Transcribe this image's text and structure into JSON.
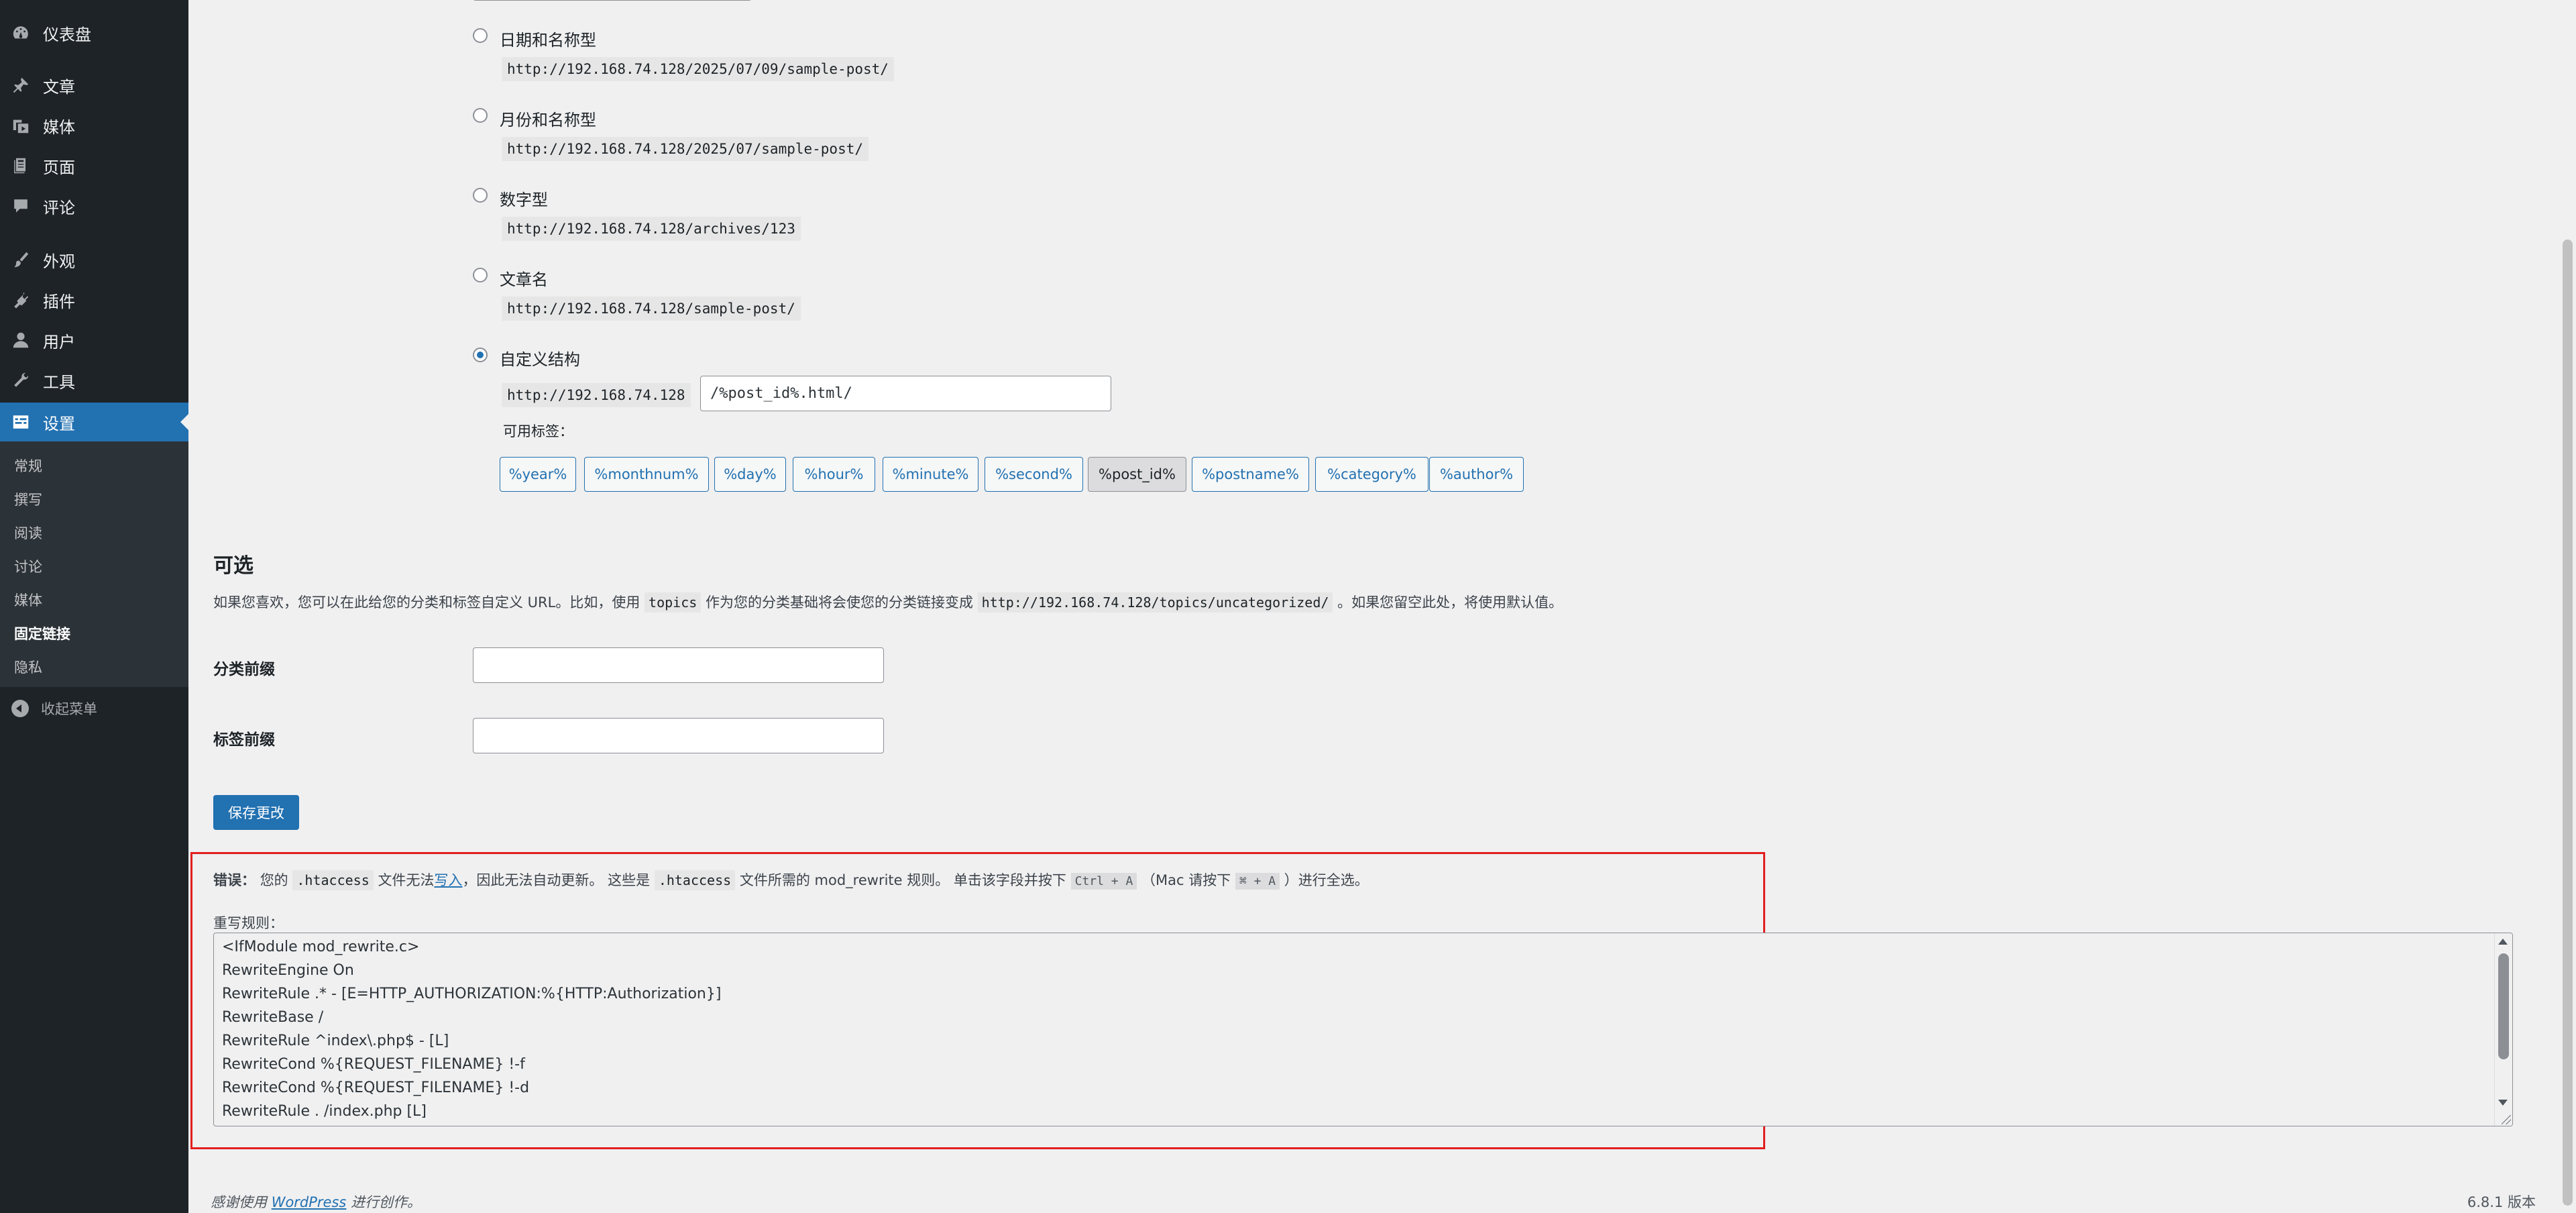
{
  "sidebar": {
    "menu": [
      {
        "label": "仪表盘",
        "icon": "dashboard-icon"
      },
      {
        "label": "文章",
        "icon": "pin-icon"
      },
      {
        "label": "媒体",
        "icon": "media-icon"
      },
      {
        "label": "页面",
        "icon": "page-icon"
      },
      {
        "label": "评论",
        "icon": "comment-icon"
      },
      {
        "label": "外观",
        "icon": "brush-icon"
      },
      {
        "label": "插件",
        "icon": "plugin-icon"
      },
      {
        "label": "用户",
        "icon": "user-icon"
      },
      {
        "label": "工具",
        "icon": "wrench-icon"
      },
      {
        "label": "设置",
        "icon": "settings-icon"
      }
    ],
    "submenu": [
      "常规",
      "撰写",
      "阅读",
      "讨论",
      "媒体",
      "固定链接",
      "隐私"
    ],
    "collapse_label": "收起菜单"
  },
  "permalink_options": [
    {
      "label": "日期和名称型",
      "url": "http://192.168.74.128/2025/07/09/sample-post/"
    },
    {
      "label": "月份和名称型",
      "url": "http://192.168.74.128/2025/07/sample-post/"
    },
    {
      "label": "数字型",
      "url": "http://192.168.74.128/archives/123"
    },
    {
      "label": "文章名",
      "url": "http://192.168.74.128/sample-post/"
    }
  ],
  "custom": {
    "label": "自定义结构",
    "base": "http://192.168.74.128",
    "value": "/%post_id%.html/",
    "available_tags_label": "可用标签：",
    "tags": [
      "%year%",
      "%monthnum%",
      "%day%",
      "%hour%",
      "%minute%",
      "%second%",
      "%post_id%",
      "%postname%",
      "%category%",
      "%author%"
    ]
  },
  "optional": {
    "heading": "可选",
    "desc_1": "如果您喜欢，您可以在此给您的分类和标签自定义 URL。比如，使用",
    "desc_code": "topics",
    "desc_2": "作为您的分类基础将会使您的分类链接变成",
    "desc_url": "http://192.168.74.128/topics/uncategorized/",
    "desc_3": "。如果您留空此处，将使用默认值。",
    "category_label": "分类前缀",
    "tag_label": "标签前缀",
    "save_label": "保存更改"
  },
  "notice": {
    "error_label": "错误：",
    "t1": "您的",
    "file": ".htaccess",
    "t2": "文件无法",
    "link": "写入",
    "t3": "，因此无法自动更新。 这些是",
    "t4": "文件所需的 mod_rewrite 规则。 单击该字段并按下",
    "kbd1": "Ctrl + A",
    "t5": "（Mac 请按下",
    "kbd2": "⌘ + A",
    "t6": "）进行全选。",
    "rules_label": "重写规则：",
    "rules": [
      "<IfModule mod_rewrite.c>",
      "RewriteEngine On",
      "RewriteRule .* - [E=HTTP_AUTHORIZATION:%{HTTP:Authorization}]",
      "RewriteBase /",
      "RewriteRule ^index\\.php$ - [L]",
      "RewriteCond %{REQUEST_FILENAME} !-f",
      "RewriteCond %{REQUEST_FILENAME} !-d",
      "RewriteRule . /index.php [L]"
    ]
  },
  "footer": {
    "thanks_1": "感谢使用",
    "wp_link": "WordPress",
    "thanks_2": "进行创作。",
    "version": "6.8.1 版本"
  }
}
